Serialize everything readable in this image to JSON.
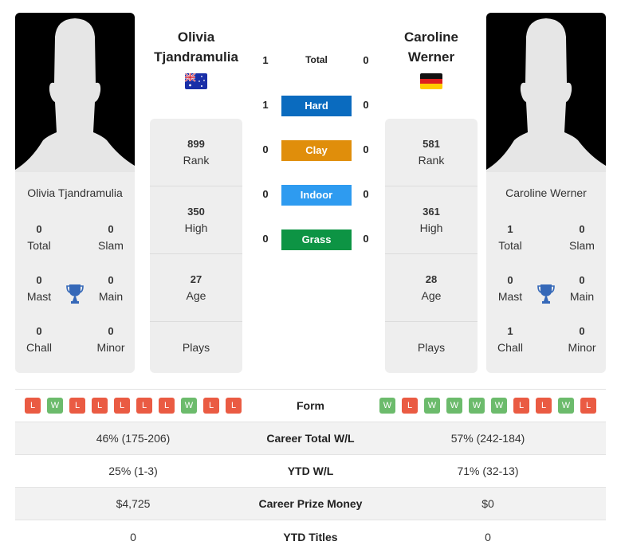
{
  "colors": {
    "hard": "#0a6bbf",
    "clay": "#e08e0b",
    "indoor": "#2e9bf0",
    "grass": "#0d9444",
    "win": "#6cbb6c",
    "loss": "#ea5b43",
    "trophy": "#3568b8"
  },
  "player_left": {
    "name_line1": "Olivia",
    "name_line2": "Tjandramulia",
    "card_name": "Olivia Tjandramulia",
    "flag": "australia-flag",
    "rank": "899",
    "rank_label": "Rank",
    "high": "350",
    "high_label": "High",
    "age": "27",
    "age_label": "Age",
    "plays_label": "Plays",
    "titles": {
      "total": "0",
      "total_label": "Total",
      "slam": "0",
      "slam_label": "Slam",
      "mast": "0",
      "mast_label": "Mast",
      "main": "0",
      "main_label": "Main",
      "chall": "0",
      "chall_label": "Chall",
      "minor": "0",
      "minor_label": "Minor"
    },
    "form": [
      "L",
      "W",
      "L",
      "L",
      "L",
      "L",
      "L",
      "W",
      "L",
      "L"
    ]
  },
  "player_right": {
    "name_line1": "Caroline",
    "name_line2": "Werner",
    "card_name": "Caroline Werner",
    "flag": "germany-flag",
    "rank": "581",
    "rank_label": "Rank",
    "high": "361",
    "high_label": "High",
    "age": "28",
    "age_label": "Age",
    "plays_label": "Plays",
    "titles": {
      "total": "1",
      "total_label": "Total",
      "slam": "0",
      "slam_label": "Slam",
      "mast": "0",
      "mast_label": "Mast",
      "main": "0",
      "main_label": "Main",
      "chall": "1",
      "chall_label": "Chall",
      "minor": "0",
      "minor_label": "Minor"
    },
    "form": [
      "W",
      "L",
      "W",
      "W",
      "W",
      "W",
      "L",
      "L",
      "W",
      "L"
    ]
  },
  "h2h": {
    "total": {
      "label": "Total",
      "left": "1",
      "right": "0"
    },
    "surfaces": [
      {
        "label": "Hard",
        "left": "1",
        "right": "0"
      },
      {
        "label": "Clay",
        "left": "0",
        "right": "0"
      },
      {
        "label": "Indoor",
        "left": "0",
        "right": "0"
      },
      {
        "label": "Grass",
        "left": "0",
        "right": "0"
      }
    ]
  },
  "comparison": {
    "form_label": "Form",
    "rows": [
      {
        "label": "Career Total W/L",
        "left": "46% (175-206)",
        "right": "57% (242-184)"
      },
      {
        "label": "YTD W/L",
        "left": "25% (1-3)",
        "right": "71% (32-13)"
      },
      {
        "label": "Career Prize Money",
        "left": "$4,725",
        "right": "$0"
      },
      {
        "label": "YTD Titles",
        "left": "0",
        "right": "0"
      }
    ]
  }
}
